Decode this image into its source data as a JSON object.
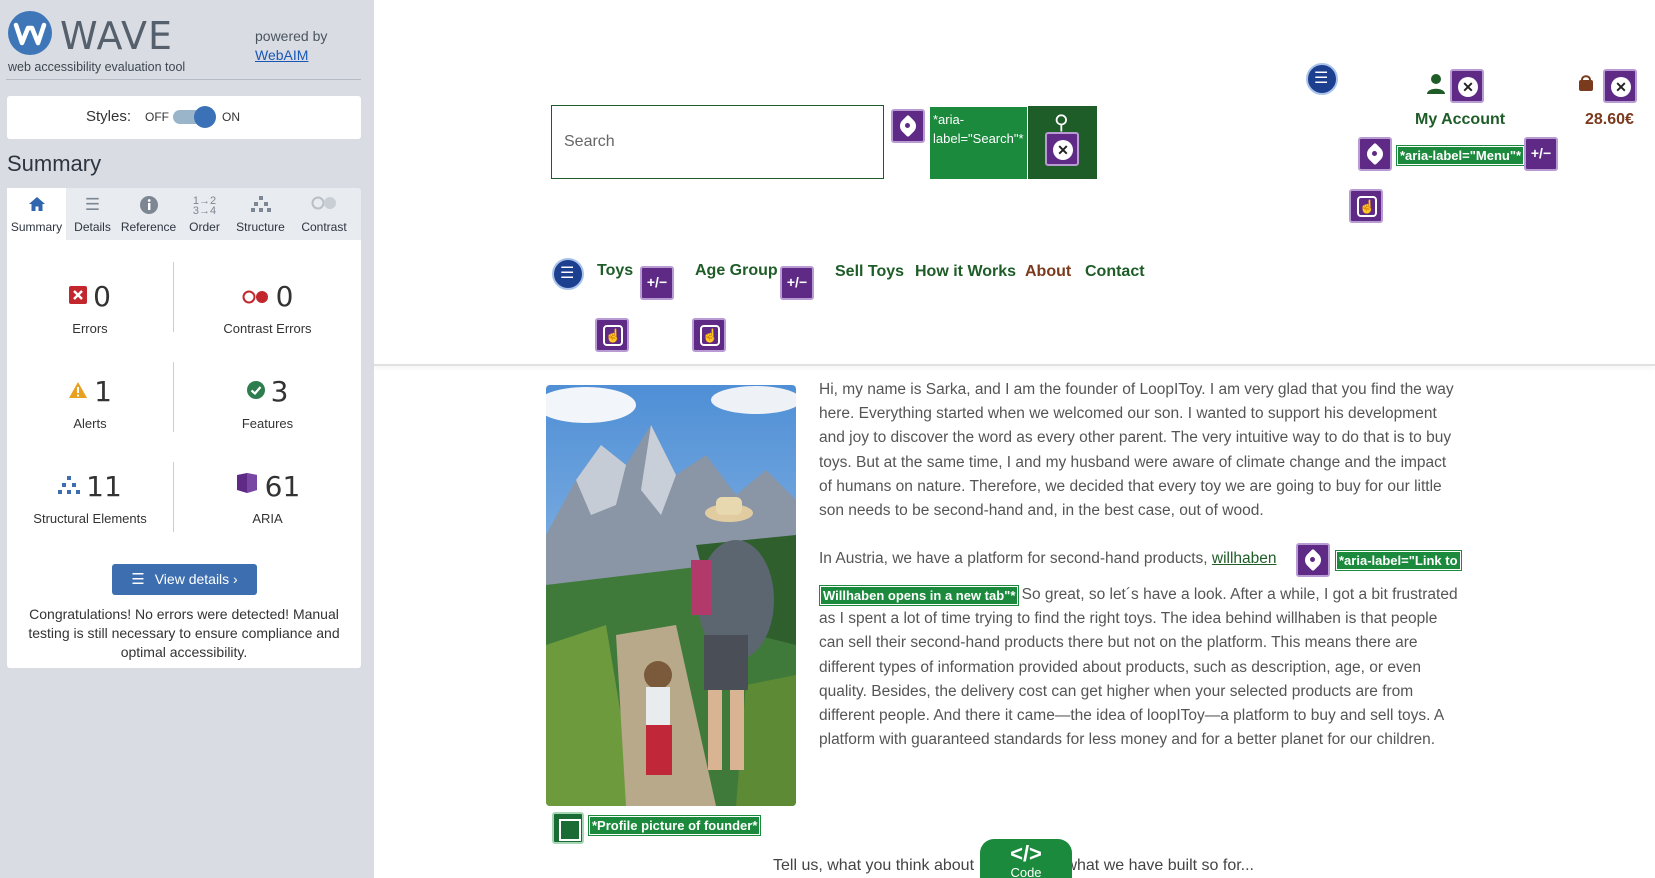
{
  "wave": {
    "title": "WAVE",
    "subtitle": "web accessibility evaluation tool",
    "powered_by": "powered by",
    "webaim_link": "WebAIM",
    "styles_label": "Styles:",
    "styles_off": "OFF",
    "styles_on": "ON",
    "summary_heading": "Summary",
    "tabs": [
      {
        "label": "Summary",
        "icon": "home-icon"
      },
      {
        "label": "Details",
        "icon": "list-icon"
      },
      {
        "label": "Reference",
        "icon": "info-icon"
      },
      {
        "label": "Order",
        "icon": "order-icon"
      },
      {
        "label": "Structure",
        "icon": "structure-icon"
      },
      {
        "label": "Contrast",
        "icon": "contrast-icon"
      }
    ],
    "stats": {
      "errors": {
        "count": "0",
        "label": "Errors"
      },
      "contrast_errors": {
        "count": "0",
        "label": "Contrast Errors"
      },
      "alerts": {
        "count": "1",
        "label": "Alerts"
      },
      "features": {
        "count": "3",
        "label": "Features"
      },
      "structural": {
        "count": "11",
        "label": "Structural Elements"
      },
      "aria": {
        "count": "61",
        "label": "ARIA"
      }
    },
    "view_details": "View details ›",
    "congrats": "Congratulations! No errors were detected! Manual testing is still necessary to ensure compliance and optimal accessibility.",
    "colors": {
      "accent": "#3d6fb0",
      "error": "#c1272d",
      "alert": "#e8a020",
      "feature": "#2e7d4f",
      "aria": "#5e2a86"
    }
  },
  "site": {
    "search_placeholder": "Search",
    "search_aria": "*aria-label=\"Search\"*",
    "account_label": "My Account",
    "cart_amount": "28.60€",
    "menu_aria": "*aria-label=\"Menu\"*",
    "nav": [
      {
        "label": "Toys"
      },
      {
        "label": "Age Group"
      },
      {
        "label": "Sell Toys"
      },
      {
        "label": "How it Works"
      },
      {
        "label": "About"
      },
      {
        "label": "Contact"
      }
    ],
    "para1": "Hi, my name is Sarka, and I am the founder of LoopIToy. I am very glad that you find the way here. Everything started when we welcomed our son. I wanted to support his development and joy to discover the word as every other parent. The very intuitive way to do that is to buy toys. But at the same time, I and my husband were aware of climate change and the impact of humans on nature. Therefore, we decided that every toy we are going to buy for our little son needs to be second-hand and, in the best case, out of wood.",
    "para2_start": "In Austria, we have a platform for second-hand products, ",
    "para2_link": "willhaben",
    "link_aria_1": "*aria-label=\"Link to",
    "link_aria_2": "Willhaben opens in a new tab\"*",
    "para2_rest": ". So great, so let´s have a look. After a while, I got a bit frustrated as I spent a lot of time trying to find the right toys. The idea behind willhaben is that people can sell their second-hand products there but not on the platform. This means there are different types of information provided about products, such as description, age, or even quality. Besides, the delivery cost can get higher when your selected products are from different people. And there it came—the idea of loopIToy—a platform to buy and sell toys. A platform with guaranteed standards for less money and for a better planet for our children.",
    "photo_alt_label": "*Profile picture of founder*",
    "tell_us_1": "Tell us, what you think about ",
    "tell_us_2": "what we have built so for...",
    "code_symbol": "</>",
    "code_label": "Code",
    "colors": {
      "brand_green": "#1e5c28",
      "active_brown": "#7a3a1e",
      "aria_green": "#1b8a3d"
    }
  }
}
